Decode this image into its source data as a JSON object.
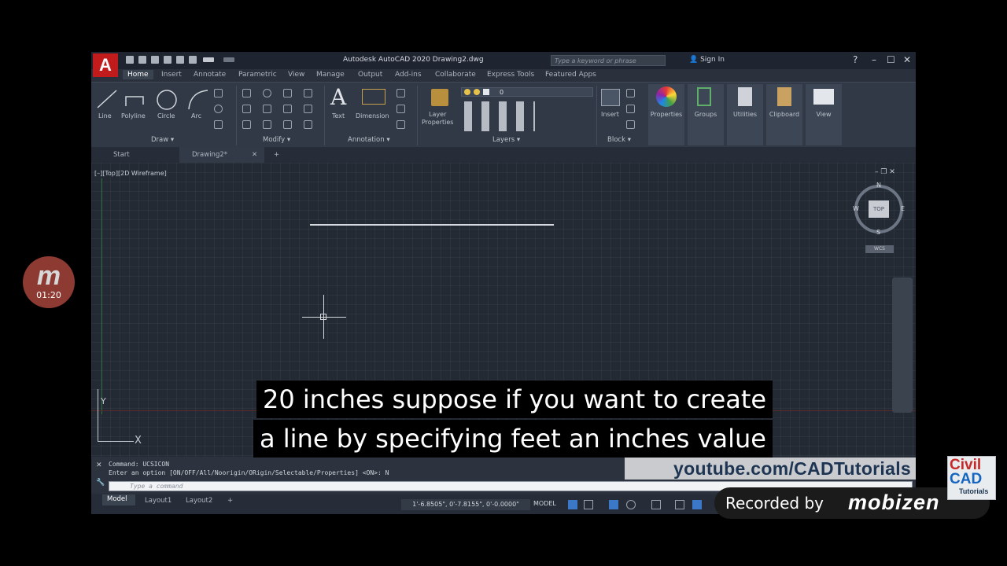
{
  "window": {
    "app_logo": "A",
    "title": "Autodesk AutoCAD 2020    Drawing2.dwg",
    "search_placeholder": "Type a keyword or phrase",
    "sign_in": "Sign In",
    "minimize": "–",
    "maximize": "☐",
    "close": "✕"
  },
  "menu_tabs": [
    "Home",
    "Insert",
    "Annotate",
    "Parametric",
    "View",
    "Manage",
    "Output",
    "Add-ins",
    "Collaborate",
    "Express Tools",
    "Featured Apps"
  ],
  "ribbon": {
    "draw": {
      "line": "Line",
      "polyline": "Polyline",
      "circle": "Circle",
      "arc": "Arc",
      "title": "Draw ▾"
    },
    "modify": {
      "title": "Modify ▾"
    },
    "annotation": {
      "text": "Text",
      "dimension": "Dimension",
      "title": "Annotation ▾"
    },
    "layers": {
      "layer_properties": "Layer\nProperties",
      "current_layer": "0",
      "title": "Layers ▾"
    },
    "block": {
      "insert": "Insert",
      "title": "Block ▾"
    },
    "properties": "Properties",
    "groups": "Groups",
    "utilities": "Utilities",
    "clipboard": "Clipboard",
    "view": "View"
  },
  "doc_tabs": {
    "start": "Start",
    "drawing": "Drawing2*",
    "close": "✕",
    "add": "+"
  },
  "viewport": {
    "label": "[–][Top][2D Wireframe]",
    "compass": {
      "n": "N",
      "s": "S",
      "e": "E",
      "w": "W",
      "top": "TOP"
    },
    "wcs": "WCS",
    "ucs_y": "Y",
    "ucs_x": "X"
  },
  "command_line": {
    "history": [
      "Command: UCSICON",
      "Enter an option [ON/OFF/All/Noorigin/ORigin/Selectable/Properties] <ON>: N"
    ],
    "placeholder": "Type a command"
  },
  "watermark": "youtube.com/CADTutorials",
  "status_bar": {
    "layout_tabs": [
      "Model",
      "Layout1",
      "Layout2",
      "+"
    ],
    "coords": "1'-6.8505\", 0'-7.8155\", 0'-0.0000\"",
    "model": "MODEL"
  },
  "subtitles": {
    "line1": "20 inches suppose if you want to create",
    "line2": "a line by specifying feet an inches value"
  },
  "mobizen": {
    "letter": "m",
    "timer": "01:20",
    "recorded_by": "Recorded by",
    "brand": "mobizen"
  },
  "logo": {
    "civil": "Civil",
    "cad": "CAD",
    "tutorials": "Tutorials"
  },
  "colors": {
    "accent": "#c11b1b",
    "panel": "#313946",
    "viewport": "#232a34",
    "watermark": "#1d3552"
  }
}
